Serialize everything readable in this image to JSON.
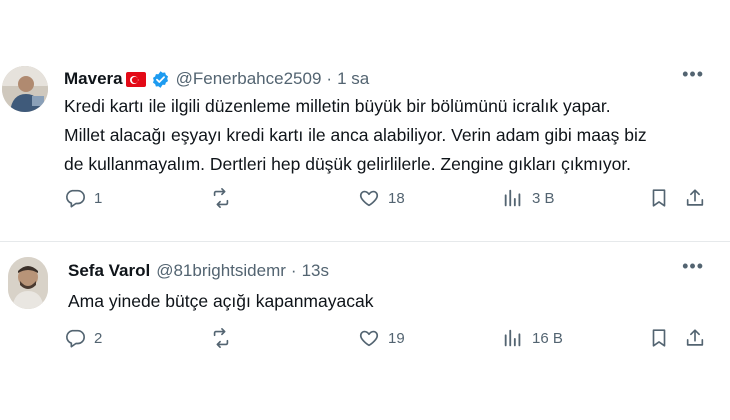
{
  "tweets": [
    {
      "name": "Mavera",
      "handle": "@Fenerbahce2509",
      "dot": "·",
      "time": "1 sa",
      "more": "•••",
      "lines": [
        "Kredi kartı ile ilgili düzenleme milletin büyük bir bölümünü icralık yapar.",
        "Millet alacağı eşyayı kredi kartı ile anca alabiliyor. Verin adam gibi maaş biz",
        "de kullanmayalım. Dertleri hep düşük gelirlilerle. Zengine gıkları çıkmıyor."
      ],
      "replies": "1",
      "retweets": "",
      "likes": "18",
      "views": "3 B"
    },
    {
      "name": "Sefa Varol",
      "handle": "@81brightsidemr",
      "dot": "·",
      "time": "13s",
      "more": "•••",
      "lines": [
        "Ama yinede bütçe açığı kapanmayacak"
      ],
      "replies": "2",
      "retweets": "",
      "likes": "19",
      "views": "16 B"
    }
  ],
  "colors": {
    "text": "#0f1419",
    "secondary": "#536471",
    "verified": "#1d9bf0",
    "flag": "#e30a17",
    "divider": "#e6e9eb"
  },
  "icons": [
    "reply-icon",
    "retweet-icon",
    "like-icon",
    "views-icon",
    "bookmark-icon",
    "share-icon",
    "verified-badge-icon",
    "turkey-flag-icon",
    "more-icon"
  ]
}
